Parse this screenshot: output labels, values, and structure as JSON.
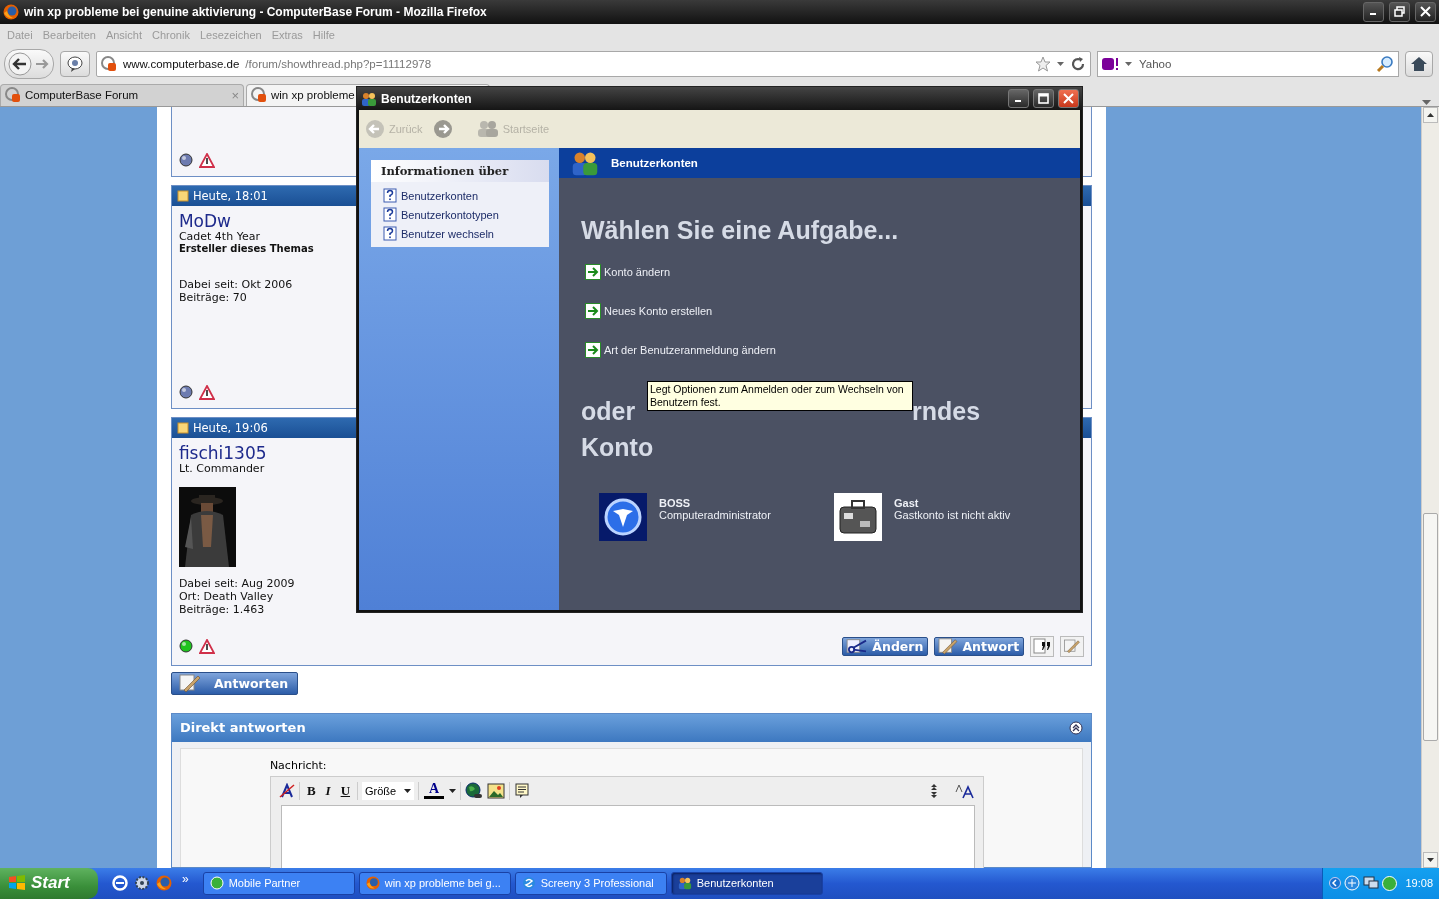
{
  "window": {
    "title": "win xp probleme bei genuine aktivierung - ComputerBase Forum - Mozilla Firefox"
  },
  "menu": [
    {
      "label": "Datei",
      "disabled": true
    },
    {
      "label": "Bearbeiten",
      "disabled": true
    },
    {
      "label": "Ansicht",
      "disabled": true
    },
    {
      "label": "Chronik",
      "disabled": true
    },
    {
      "label": "Lesezeichen",
      "disabled": true
    },
    {
      "label": "Extras",
      "disabled": true
    },
    {
      "label": "Hilfe",
      "disabled": true
    }
  ],
  "address": {
    "host": "www.computerbase.de",
    "path": "/forum/showthread.php?p=11112978"
  },
  "search": {
    "placeholder": "Yahoo"
  },
  "tabs": [
    {
      "label": "ComputerBase Forum",
      "close": "×",
      "selected": false
    },
    {
      "label": "win xp probleme",
      "selected": true
    }
  ],
  "posts": [
    {
      "online": false
    },
    {
      "date": "Heute, 18:01",
      "user": "MoDw",
      "rank": "Cadet 4th Year",
      "role": "Ersteller dieses Themas",
      "details": [
        "Dabei seit: Okt 2006",
        "Beiträge: 70"
      ],
      "online": false
    },
    {
      "date": "Heute, 19:06",
      "user": "fischi1305",
      "rank": "Lt. Commander",
      "avatar": {
        "kind": "picture"
      },
      "details": [
        "Dabei seit: Aug 2009",
        "Ort: Death Valley",
        "Beiträge: 1.463"
      ],
      "online": true,
      "actions": [
        {
          "kind": "edit",
          "label": "Ändern"
        },
        {
          "kind": "reply",
          "label": "Antwort"
        },
        {
          "kind": "quote"
        },
        {
          "kind": "multiquote"
        }
      ]
    }
  ],
  "reply_button": "Antworten",
  "quick_reply": {
    "title": "Direkt antworten",
    "message_label": "Nachricht:",
    "bold": "B",
    "italic": "I",
    "underline": "U",
    "size": "Größe",
    "font_color": "A"
  },
  "dialog": {
    "title": "Benutzerkonten",
    "toolbar": [
      {
        "kind": "back",
        "label": "Zurück",
        "disabled": true
      },
      {
        "kind": "forward",
        "disabled": false
      },
      {
        "kind": "home",
        "label": "Startseite",
        "disabled": true
      }
    ],
    "info_title": "Informationen über",
    "info_links": [
      "Benutzerkonten",
      "Benutzerkontotypen",
      "Benutzer wechseln"
    ],
    "header": "Benutzerkonten",
    "heading": "Wählen Sie eine Aufgabe...",
    "tasks": [
      "Konto ändern",
      "Neues Konto erstellen",
      "Art der Benutzeranmeldung ändern"
    ],
    "heading2": {
      "left": "oder",
      "right": "rndes",
      "line2": "Konto"
    },
    "accounts": [
      {
        "kind": "admin",
        "name": "BOSS",
        "type": "Computeradministrator"
      },
      {
        "kind": "guest",
        "name": "Gast",
        "type": "Gastkonto ist nicht aktiv"
      }
    ],
    "tooltip": "Legt Optionen zum Anmelden oder zum Wechseln von Benutzern fest."
  },
  "taskbar": {
    "start": "Start",
    "overflow": "»",
    "tasks": [
      {
        "kind": "app",
        "label": "Mobile Partner",
        "selected": false
      },
      {
        "kind": "browser",
        "label": "win xp probleme bei g...",
        "selected": false
      },
      {
        "kind": "screeny",
        "label": "Screeny 3 Professional",
        "selected": false
      },
      {
        "kind": "users",
        "label": "Benutzerkonten",
        "selected": true
      }
    ],
    "clock": "19:08"
  }
}
